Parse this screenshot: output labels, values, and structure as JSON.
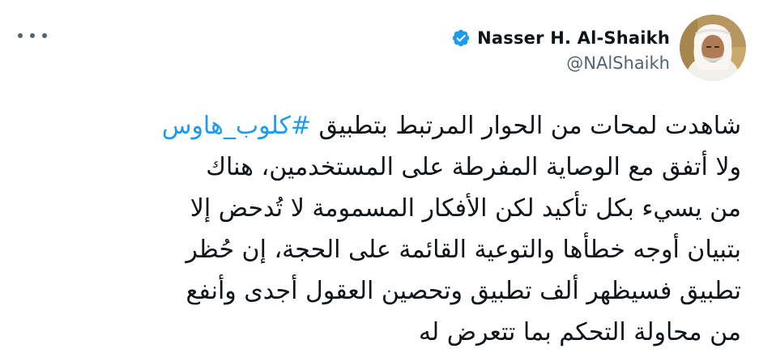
{
  "author": {
    "display_name": "Nasser H. Al-Shaikh",
    "handle": "@NAlShaikh",
    "verified": true,
    "avatar_icon": "profile-photo"
  },
  "menu": {
    "icon": "more-horizontal-icon"
  },
  "tweet": {
    "line1_text": "شاهدت لمحات من الحوار المرتبط بتطبيق ",
    "hashtag": "#كلوب_هاوس",
    "line2": "ولا أتفق مع الوصاية المفرطة على المستخدمين، هناك",
    "line3": "من يسيء بكل تأكيد لكن الأفكار المسمومة لا تُدحض إلا",
    "line4": "بتبيان أوجه خطأها والتوعية القائمة على الحجة، إن حُظر",
    "line5": "تطبيق فسيظهر ألف تطبيق وتحصين العقول أجدى وأنفع",
    "line6": "من محاولة التحكم بما تتعرض له"
  },
  "colors": {
    "link": "#1d9bf0",
    "text": "#0f1419",
    "secondary": "#536471",
    "verified": "#1d9bf0"
  }
}
